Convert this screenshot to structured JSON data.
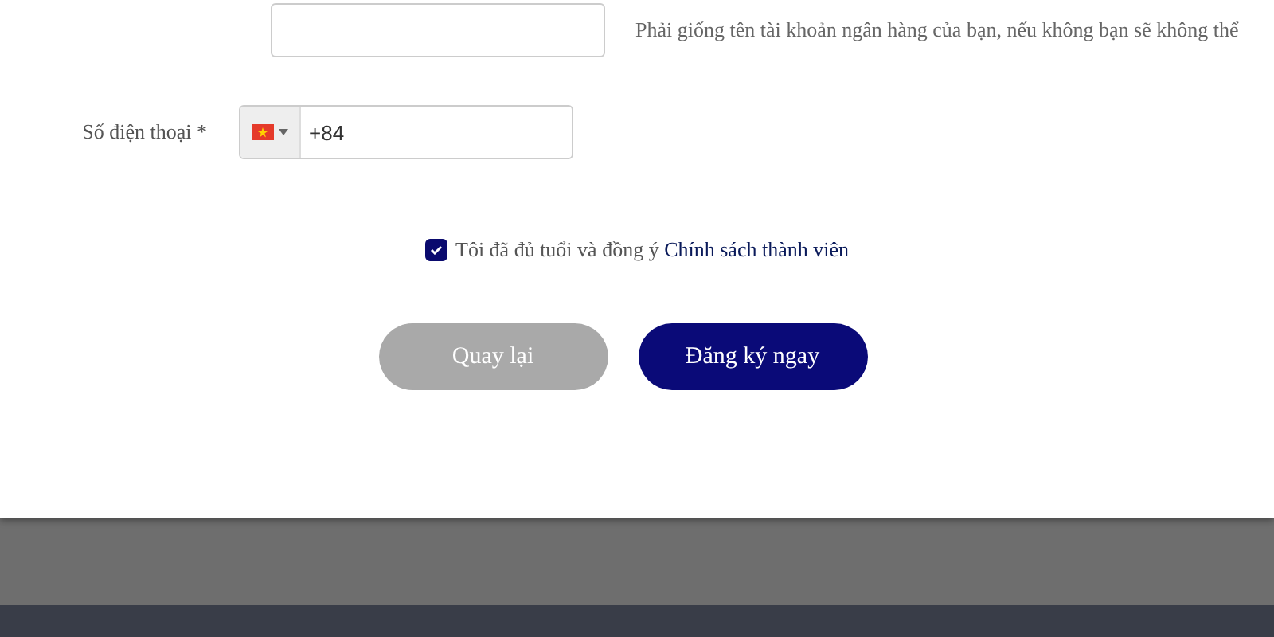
{
  "name_field": {
    "hint": "Phải giống tên tài khoản ngân hàng của bạn, nếu không bạn sẽ không thể"
  },
  "phone_field": {
    "label": "Số điện thoại *",
    "value": "+84"
  },
  "agreement": {
    "checked": true,
    "text": "Tôi đã đủ tuổi và đồng ý",
    "link": "Chính sách thành viên"
  },
  "buttons": [
    {
      "label": "Quay lại",
      "kind": "secondary"
    },
    {
      "label": "Đăng ký ngay",
      "kind": "primary"
    }
  ]
}
